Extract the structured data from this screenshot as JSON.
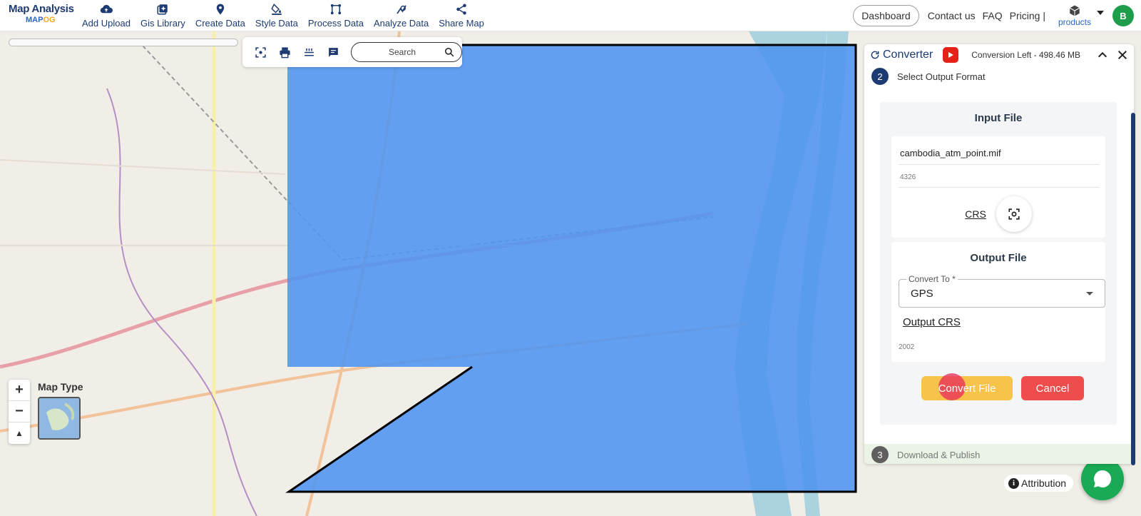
{
  "app": {
    "brand_title": "Map Analysis",
    "brand_sub_main": "MAP",
    "brand_sub_accent": "OG"
  },
  "nav": {
    "items": [
      {
        "label": "Add Upload",
        "icon": "cloud-upload-icon"
      },
      {
        "label": "Gis Library",
        "icon": "library-icon"
      },
      {
        "label": "Create Data",
        "icon": "map-pin-icon"
      },
      {
        "label": "Style Data",
        "icon": "paint-bucket-icon"
      },
      {
        "label": "Process Data",
        "icon": "process-icon"
      },
      {
        "label": "Analyze Data",
        "icon": "analyze-icon"
      },
      {
        "label": "Share Map",
        "icon": "share-icon"
      }
    ],
    "dashboard": "Dashboard",
    "contact": "Contact us",
    "faq": "FAQ",
    "pricing": "Pricing |",
    "products": "products",
    "avatar_initial": "B"
  },
  "map": {
    "search_placeholder": "Search",
    "maptype_label": "Map Type",
    "zoom_in": "+",
    "zoom_out": "−",
    "north": "▲",
    "attribution": "Attribution",
    "attribution_icon": "i"
  },
  "converter": {
    "title": "Converter",
    "conversion_left": "Conversion Left - 498.46 MB",
    "step2_num": "2",
    "step2_label": "Select Output Format",
    "input_title": "Input File",
    "input_filename": "cambodia_atm_point.mif",
    "input_crs_value": "4326",
    "crs_link": "CRS",
    "output_title": "Output File",
    "convert_to_label": "Convert To *",
    "convert_to_value": "GPS",
    "output_crs_link": "Output CRS",
    "output_crs_value": "2002",
    "convert_button": "Convert File",
    "cancel_button": "Cancel",
    "step3_num": "3",
    "step3_label": "Download & Publish"
  },
  "colors": {
    "brand": "#1d3b73",
    "accent": "#2a64c7",
    "selection_fill": "#4d94f0",
    "convert": "#f8c34a",
    "cancel": "#ef4c4c",
    "chat": "#1aaa55"
  }
}
